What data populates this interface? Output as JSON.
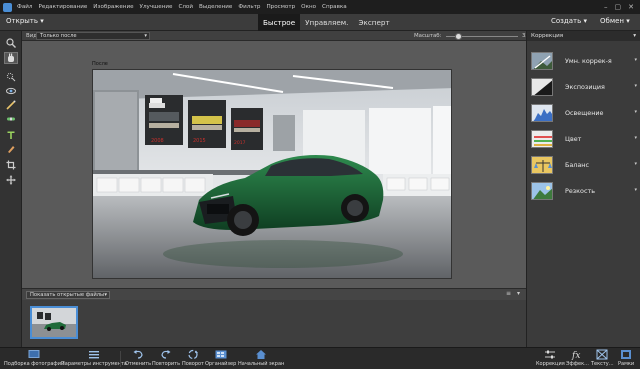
{
  "menu": {
    "items": [
      "Файл",
      "Редактирование",
      "Изображение",
      "Улучшение",
      "Слой",
      "Выделение",
      "Фильтр",
      "Просмотр",
      "Окно",
      "Справка"
    ]
  },
  "mode_bar": {
    "open_label": "Открыть",
    "tabs": [
      "Быстрое",
      "Управляем.",
      "Эксперт"
    ],
    "active_tab": "Быстрое",
    "create_label": "Создать",
    "share_label": "Обмен"
  },
  "options_bar": {
    "view_label": "Вид:",
    "view_value": "Только после",
    "zoom_label": "Масштаб:",
    "zoom_value": "33%",
    "zoom_fraction": 0.33
  },
  "canvas": {
    "doc_label": "После"
  },
  "panel": {
    "title": "Коррекция",
    "items": [
      {
        "label": "Умн. коррек-я",
        "icon": "smart-fix-icon"
      },
      {
        "label": "Экспозиция",
        "icon": "exposure-icon"
      },
      {
        "label": "Освещение",
        "icon": "lighting-icon"
      },
      {
        "label": "Цвет",
        "icon": "color-icon"
      },
      {
        "label": "Баланс",
        "icon": "balance-icon"
      },
      {
        "label": "Резкость",
        "icon": "sharpen-icon"
      }
    ]
  },
  "bin": {
    "select_value": "Показать открытые файлы"
  },
  "taskbar": {
    "left": [
      {
        "label": "Подборка фотографий",
        "icon": "photo-bin-icon"
      },
      {
        "label": "Параметры инструмента",
        "icon": "tool-options-icon"
      },
      {
        "label": "Отменить",
        "icon": "undo-icon"
      },
      {
        "label": "Повторить",
        "icon": "redo-icon"
      },
      {
        "label": "Поворот",
        "icon": "rotate-icon"
      },
      {
        "label": "Органайзер",
        "icon": "organizer-icon"
      },
      {
        "label": "Начальный экран",
        "icon": "home-icon"
      }
    ],
    "right": [
      {
        "label": "Коррекция",
        "icon": "adjustments-icon"
      },
      {
        "label": "Эффек...",
        "icon": "effects-icon"
      },
      {
        "label": "Тексту...",
        "icon": "textures-icon"
      },
      {
        "label": "Рамки",
        "icon": "frames-icon"
      }
    ]
  },
  "colors": {
    "accent": "#4a8ed6",
    "car_green": "#1f6b3a",
    "chrome_bg": "#3b3b3b"
  }
}
